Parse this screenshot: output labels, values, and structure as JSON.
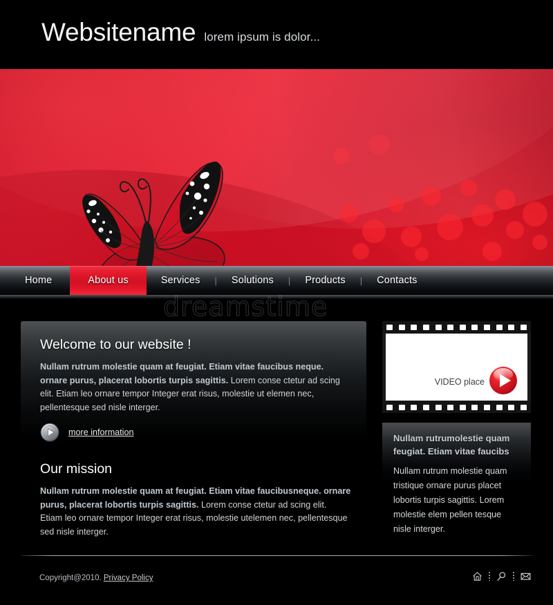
{
  "header": {
    "site_title": "Websitename",
    "tagline": "lorem ipsum is dolor..."
  },
  "banner": {
    "graphic": "butterfly-illustration",
    "background_color": "#d8152b"
  },
  "nav": {
    "items": [
      {
        "label": "Home",
        "active": false
      },
      {
        "label": "About us",
        "active": true
      },
      {
        "label": "Services",
        "active": false
      },
      {
        "label": "Solutions",
        "active": false
      },
      {
        "label": "Products",
        "active": false
      },
      {
        "label": "Contacts",
        "active": false
      }
    ],
    "separator": "|",
    "active_color": "#df1628"
  },
  "watermark": {
    "text": "dreamstime"
  },
  "main": {
    "welcome": {
      "title": "Welcome to our website !",
      "bold": "Nullam rutrum molestie quam at feugiat. Etiam vitae faucibus neque. ornare purus, placerat lobortis turpis sagittis.",
      "rest": " Lorem  conse ctetur ad scing elit. Etiam  leo ornare  tempor Integer erat risus, molestie ut elemen nec, pellentesque sed nisle interger."
    },
    "more_link": {
      "label": "more information",
      "icon": "play-circle-icon"
    },
    "mission": {
      "title": "Our mission",
      "bold": "Nullam rutrum molestie quam at feugiat. Etiam vitae faucibusneque. ornare purus, placerat lobortis turpis sagittis.",
      "rest": " Lorem  conse ctetur ad scing elit. Etiam  leo ornare  tempor Integer erat risus, molestie utelemen nec, pellentesque sed nisle interger."
    }
  },
  "sidebar": {
    "video": {
      "placeholder_label": "VIDEO place",
      "play_icon": "play-button-red-icon",
      "sprocket_count": 12
    },
    "promo": {
      "heading": "Nullam rutrumolestie quam feugiat. Etiam vitae faucibs",
      "body": "Nullam rutrum molestie quam tristique ornare purus placet lobortis turpis sagittis. Lorem molestie elem pellen tesque nisle interger."
    }
  },
  "footer": {
    "copyright": "Copyright@2010.",
    "privacy_link": "Privacy Policy",
    "icons": [
      {
        "name": "home-icon"
      },
      {
        "name": "search-icon"
      },
      {
        "name": "mail-icon"
      }
    ]
  }
}
